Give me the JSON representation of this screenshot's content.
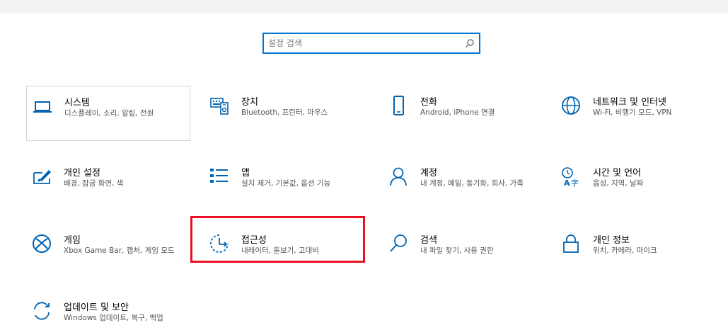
{
  "search": {
    "placeholder": "설정 검색"
  },
  "tiles": [
    {
      "title": "시스템",
      "desc": "디스플레이, 소리, 알림, 전원",
      "icon": "laptop-icon"
    },
    {
      "title": "장치",
      "desc": "Bluetooth, 프린터, 마우스",
      "icon": "devices-icon"
    },
    {
      "title": "전화",
      "desc": "Android, iPhone 연결",
      "icon": "phone-icon"
    },
    {
      "title": "네트워크 및 인터넷",
      "desc": "Wi-Fi, 비행기 모드, VPN",
      "icon": "globe-icon"
    },
    {
      "title": "개인 설정",
      "desc": "배경, 잠금 화면, 색",
      "icon": "personalization-icon"
    },
    {
      "title": "앱",
      "desc": "설치 제거, 기본값, 옵션 기능",
      "icon": "apps-list-icon"
    },
    {
      "title": "계정",
      "desc": "내 계정, 메일, 동기화, 회사, 가족",
      "icon": "person-icon"
    },
    {
      "title": "시간 및 언어",
      "desc": "음성, 지역, 날짜",
      "icon": "time-language-icon"
    },
    {
      "title": "게임",
      "desc": "Xbox Game Bar, 캡처, 게임 모드",
      "icon": "xbox-icon"
    },
    {
      "title": "접근성",
      "desc": "내레이터, 돋보기, 고대비",
      "icon": "ease-of-access-icon"
    },
    {
      "title": "검색",
      "desc": "내 파일 찾기, 사용 권한",
      "icon": "search-icon"
    },
    {
      "title": "개인 정보",
      "desc": "위치, 카메라, 마이크",
      "icon": "lock-icon"
    },
    {
      "title": "업데이트 및 보안",
      "desc": "Windows 업데이트, 복구, 백업",
      "icon": "update-icon"
    }
  ],
  "colors": {
    "accent": "#0078d7",
    "highlight": "#e81123"
  }
}
